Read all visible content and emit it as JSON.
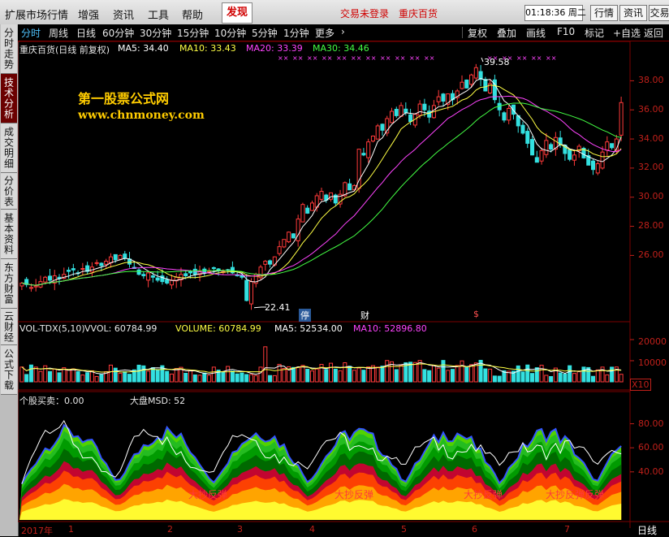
{
  "menubar": {
    "items": [
      "扩展市场行情",
      "增强",
      "资讯",
      "工具",
      "帮助"
    ],
    "find_label": "发现",
    "trade_status": "交易未登录",
    "stock_name_status": "重庆百货",
    "clock": "01:18:36 周二",
    "right_buttons": [
      "行情",
      "资讯",
      "交易"
    ]
  },
  "sidebar": {
    "tabs": [
      {
        "label": "分时走势",
        "active": false
      },
      {
        "label": "技术分析",
        "active": true
      },
      {
        "label": "成交明细",
        "active": false
      },
      {
        "label": "分价表",
        "active": false
      },
      {
        "label": "基本资料",
        "active": false
      },
      {
        "label": "东方财富",
        "active": false
      },
      {
        "label": "云财经",
        "active": false
      },
      {
        "label": "公式下载",
        "active": false
      }
    ]
  },
  "periodbar": {
    "periods": [
      "分时",
      "周线",
      "日线",
      "60分钟",
      "30分钟",
      "15分钟",
      "10分钟",
      "5分钟",
      "1分钟",
      "更多"
    ],
    "active_period": "分时",
    "more_arrow": "›",
    "tools": [
      "复权",
      "叠加",
      "画线",
      "F10",
      "标记",
      "+自选",
      "返回"
    ]
  },
  "price_panel": {
    "title": "重庆百货(日线 前复权)",
    "ma5": "MA5: 34.40",
    "ma10": "MA10: 33.43",
    "ma20": "MA20: 33.39",
    "ma30": "MA30: 34.46",
    "watermark_title": "第一股票公式网",
    "watermark_url": "www.chnmoney.com",
    "high_label": "39.58",
    "low_label": "22.41",
    "event_label_1": "停",
    "event_label_2": "财",
    "event_label_3": "$",
    "axis": [
      "38.00",
      "36.00",
      "34.00",
      "32.00",
      "30.00",
      "28.00",
      "26.00"
    ]
  },
  "volume_panel": {
    "title": "VOL-TDX(5,10)",
    "vvol": "VVOL: 60784.99",
    "volume": "VOLUME: 60784.99",
    "ma5": "MA5: 52534.00",
    "ma10": "MA10: 52896.80",
    "axis": [
      "20000",
      "10000"
    ],
    "unit": "X10"
  },
  "indicator_panel": {
    "title": "个股买卖：0.00",
    "msd": "大盘MSD: 52",
    "axis": [
      "80.00",
      "60.00",
      "40.00"
    ],
    "annotations": [
      "大抄反弹",
      "大抄反弹",
      "大抄反弹",
      "大抄反弹反弹"
    ]
  },
  "bottom_axis": {
    "year": "2017年",
    "months": [
      "1",
      "2",
      "3",
      "4",
      "5",
      "6",
      "7"
    ],
    "right_label": "日线"
  },
  "colors": {
    "ma5": "#ffffff",
    "ma10": "#ffff44",
    "ma20": "#ff44ff",
    "ma30": "#44ff44",
    "up": "#ff3a3a",
    "down": "#33e0e0",
    "axis": "#c0201a"
  },
  "chart_data": {
    "type": "candlestick",
    "title": "重庆百货(日线 前复权)",
    "y_axis_ticks": [
      26,
      28,
      30,
      32,
      34,
      36,
      38
    ],
    "ylim": [
      21.5,
      40.2
    ],
    "x_labels": [
      "2017年",
      "1",
      "2",
      "3",
      "4",
      "5",
      "6",
      "7"
    ],
    "annotated_high": 39.58,
    "annotated_low": 22.41,
    "ma_values_last": {
      "MA5": 34.4,
      "MA10": 33.43,
      "MA20": 33.39,
      "MA30": 34.46
    },
    "close_approx": [
      24.1,
      24.0,
      23.8,
      23.9,
      24.2,
      24.5,
      24.3,
      24.6,
      24.4,
      24.7,
      24.9,
      25.0,
      24.8,
      25.1,
      24.9,
      25.2,
      25.5,
      25.3,
      25.6,
      25.9,
      25.7,
      26.0,
      25.8,
      25.4,
      25.1,
      24.7,
      24.6,
      24.8,
      24.5,
      24.3,
      24.2,
      24.1,
      24.3,
      24.5,
      24.7,
      24.6,
      24.8,
      24.7,
      24.9,
      24.8,
      24.9,
      25.1,
      25.0,
      24.9,
      25.0,
      24.8,
      24.6,
      24.5,
      22.9,
      24.2,
      24.7,
      25.2,
      25.6,
      25.4,
      25.9,
      26.6,
      27.1,
      27.6,
      27.2,
      28.5,
      29.5,
      28.9,
      29.6,
      30.1,
      30.4,
      29.8,
      30.3,
      29.6,
      30.2,
      31.0,
      30.5,
      30.8,
      33.3,
      32.9,
      33.8,
      34.2,
      34.9,
      34.6,
      35.4,
      35.9,
      35.6,
      36.3,
      35.8,
      35.2,
      35.7,
      36.4,
      36.0,
      35.5,
      36.3,
      36.9,
      36.6,
      37.1,
      36.7,
      37.3,
      37.9,
      37.5,
      38.4,
      38.9,
      38.1,
      37.3,
      37.8,
      36.7,
      36.0,
      35.3,
      36.1,
      35.7,
      34.9,
      34.4,
      33.7,
      32.9,
      32.4,
      33.2,
      33.9,
      33.3,
      34.1,
      33.6,
      33.0,
      32.6,
      32.9,
      33.5,
      32.7,
      32.2,
      31.9,
      32.3,
      33.1,
      33.8,
      33.4,
      34.0,
      36.5
    ],
    "volume_ticks": [
      10000,
      20000
    ],
    "volume_unit": "X10",
    "volume_last": 60784.99,
    "volume_ma5": 52534.0,
    "volume_ma10": 52896.8,
    "indicator_ticks": [
      40,
      60,
      80
    ],
    "indicator_value": 0.0,
    "market_msd": 52
  }
}
